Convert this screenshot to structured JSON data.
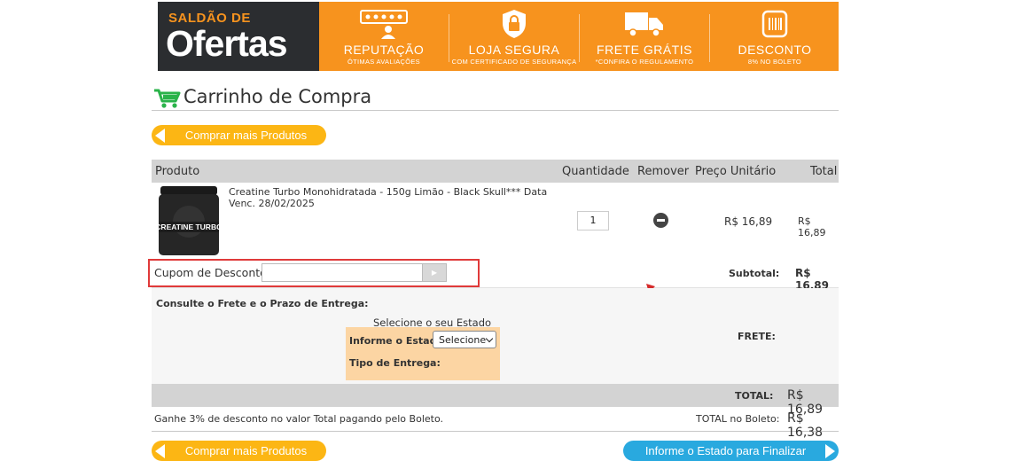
{
  "banner": {
    "logo_small": "SALDÃO DE",
    "logo_big": "Ofertas",
    "features": [
      {
        "title": "REPUTAÇÃO",
        "subtitle": "ÓTIMAS AVALIAÇÕES",
        "icon": "rating-stars-icon"
      },
      {
        "title": "LOJA SEGURA",
        "subtitle": "COM CERTIFICADO DE SEGURANÇA",
        "icon": "padlock-icon"
      },
      {
        "title": "FRETE GRÁTIS",
        "subtitle": "*CONFIRA O REGULAMENTO",
        "icon": "delivery-truck-icon"
      },
      {
        "title": "DESCONTO",
        "subtitle": "8% NO BOLETO",
        "icon": "barcode-icon"
      }
    ]
  },
  "page": {
    "title": "Carrinho de Compra",
    "title_icon": "shopping-cart-icon"
  },
  "buttons": {
    "more_products_top": "Comprar mais Produtos",
    "more_products_bottom": "Comprar mais Produtos",
    "finalize": "Informe o Estado para Finalizar"
  },
  "table": {
    "headers": {
      "product": "Produto",
      "quantity": "Quantidade",
      "remove": "Remover",
      "unit_price": "Preço Unitário",
      "total": "Total"
    },
    "items": [
      {
        "name": "Creatine Turbo Monohidratada - 150g Limão - Black Skull*** Data Venc. 28/02/2025",
        "image_label": "CREATINE TURBO",
        "quantity": "1",
        "unit_price": "R$ 16,89",
        "total": "R$ 16,89"
      }
    ]
  },
  "coupon": {
    "label": "Cupom de Desconto:",
    "value": "",
    "apply_glyph": "▶"
  },
  "subtotal": {
    "label": "Subtotal:",
    "value": "R$ 16,89"
  },
  "shipping": {
    "title": "Consulte o Frete e o Prazo de Entrega:",
    "select_caption": "Selecione o seu Estado",
    "state_label": "Informe o Estado:",
    "state_selected": "Selecione",
    "delivery_type_label": "Tipo de Entrega:",
    "frete_label": "FRETE:"
  },
  "totals": {
    "total_label": "TOTAL:",
    "total_value": "R$ 16,89",
    "boleto_note": "Ganhe 3% de desconto no valor Total pagando pelo Boleto.",
    "boleto_label": "TOTAL no Boleto:",
    "boleto_value": "R$ 16,38"
  },
  "colors": {
    "banner_orange": "#f7931e",
    "pill_orange": "#fcb614",
    "pill_blue": "#29a9df",
    "highlight_red": "#e03a3a",
    "cart_green": "#2ab34a"
  }
}
